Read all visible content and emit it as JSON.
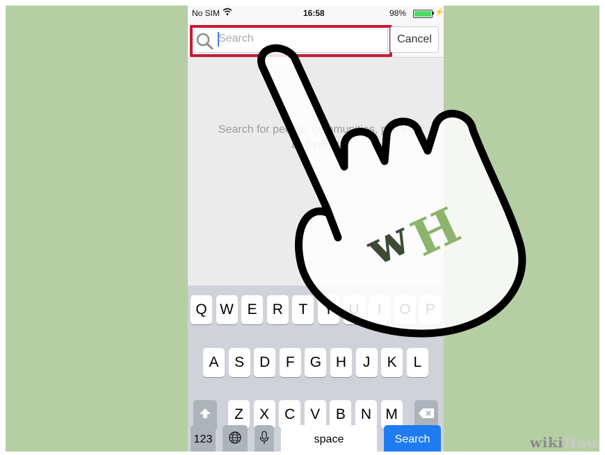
{
  "status_bar": {
    "carrier": "No SIM",
    "time": "16:58",
    "battery_percent_text": "98%",
    "battery_level": 0.98,
    "wifi_icon": "wifi-icon",
    "charging_icon": "charging-bolt-icon"
  },
  "search": {
    "placeholder": "Search",
    "cancel_label": "Cancel",
    "search_icon": "magnifier-icon"
  },
  "hint": {
    "line1": "Search for people, communities, places",
    "line2": "and posts"
  },
  "keyboard": {
    "row1": [
      "Q",
      "W",
      "E",
      "R",
      "T",
      "Y",
      "U",
      "I",
      "O",
      "P"
    ],
    "row2": [
      "A",
      "S",
      "D",
      "F",
      "G",
      "H",
      "J",
      "K",
      "L"
    ],
    "row3": [
      "Z",
      "X",
      "C",
      "V",
      "B",
      "N",
      "M"
    ],
    "numbers_label": "123",
    "space_label": "space",
    "search_label": "Search",
    "shift_icon": "shift-arrow-icon",
    "delete_icon": "backspace-icon",
    "globe_icon": "globe-icon",
    "mic_icon": "microphone-icon"
  },
  "overlay": {
    "hand_icon": "pointing-hand-icon",
    "logo_w": "w",
    "logo_h": "H"
  },
  "watermark": {
    "part1": "wiki",
    "part2": "How"
  },
  "colors": {
    "background": "#b5cea3",
    "highlight": "#c61b34",
    "search_key": "#1f7bf2",
    "logo_w": "#3d4a35",
    "logo_h": "#8cb46c"
  }
}
